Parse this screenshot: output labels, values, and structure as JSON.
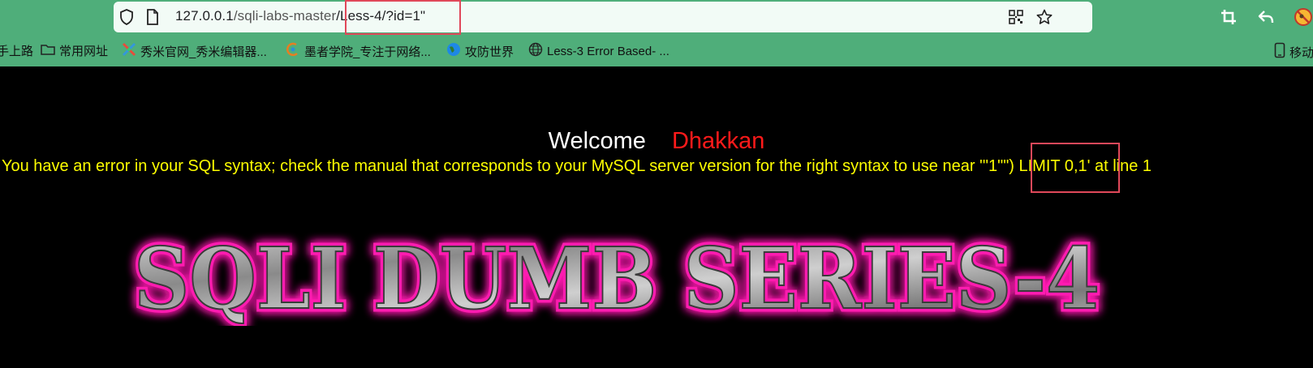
{
  "browser": {
    "url_host": "127.0.0.1",
    "url_path_before": "/sqli-labs-maste",
    "url_path_cut": "r",
    "url_path_after": "/Less-4/?id=1\"",
    "icons": [
      "shield-icon",
      "page-icon",
      "qr-code-icon",
      "star-icon",
      "crop-icon",
      "undo-icon",
      "extension-icon"
    ]
  },
  "bookmarks": [
    {
      "icon": "partial",
      "label": "手上路"
    },
    {
      "icon": "folder-icon",
      "label": "常用网址"
    },
    {
      "icon": "xiumi-icon",
      "label": "秀米官网_秀米编辑器..."
    },
    {
      "icon": "mozhe-icon",
      "label": "墨者学院_专注于网络..."
    },
    {
      "icon": "globe-color-icon",
      "label": "攻防世界"
    },
    {
      "icon": "globe-icon",
      "label": "Less-3 Error Based- ..."
    },
    {
      "icon": "mobile-icon",
      "label": "移动"
    }
  ],
  "page": {
    "welcome": "Welcome",
    "name": "Dhakkan",
    "error": "You have an error in your SQL syntax; check the manual that corresponds to your MySQL server version for the right syntax to use near '\"1\"\") LIMIT 0,1' at line 1",
    "banner": "SQLI DUMB SERIES-4",
    "colors": {
      "welcome": "#ffffff",
      "name": "#ff1a1a",
      "error": "#ffff00",
      "banner_glow": "#ff1ab0",
      "browser_chrome": "#4fae7a"
    }
  }
}
